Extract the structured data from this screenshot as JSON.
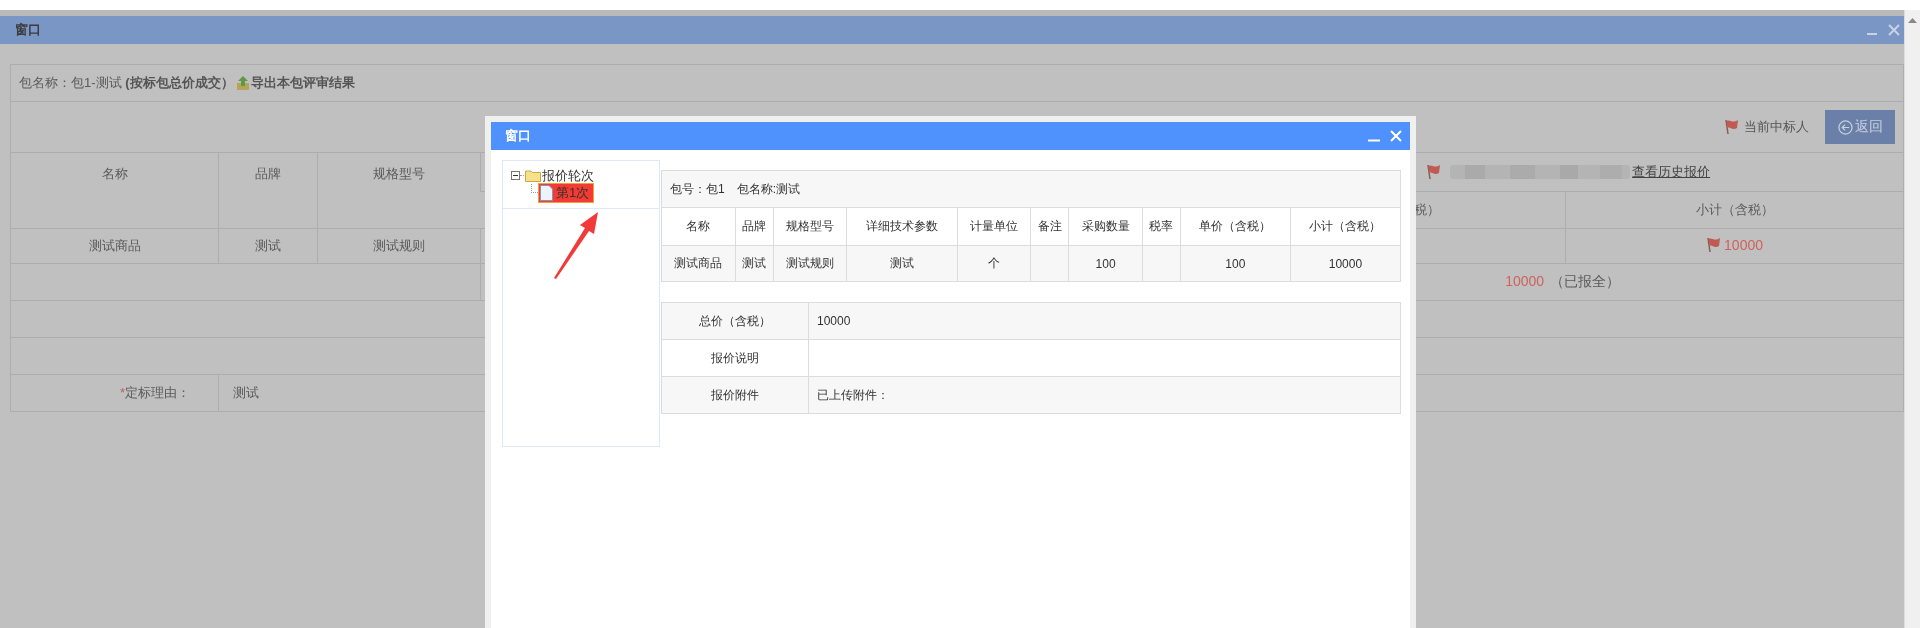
{
  "background_window": {
    "title": "窗口",
    "package_line": {
      "text": "包名称：包1-测试 **(按标包总价成交）**",
      "export_link": "导出本包评审结果"
    },
    "toolbar": {
      "winner_legend": "当前中标人",
      "back_button": "返回"
    },
    "table": {
      "columns": [
        "名称",
        "品牌",
        "规格型号"
      ],
      "supplier": {
        "history_link": "查看历史报价",
        "column_fragment": "税）",
        "subtotal_header": "小计（含税）"
      },
      "rows": [
        {
          "cells": [
            "测试商品",
            "测试",
            "测试规则"
          ],
          "subtotal": "10000",
          "winner": true
        }
      ],
      "total": {
        "amount": "10000",
        "status": "（已报全）"
      },
      "reason": {
        "required_mark": "*",
        "label": "定标理由：",
        "value": "测试"
      }
    }
  },
  "dialog": {
    "title": "窗口",
    "tree": [
      {
        "label": "报价轮次",
        "expanded": true,
        "children": [
          {
            "label": "第1次",
            "selected": true
          }
        ]
      }
    ],
    "package_info": "包号：包1　包名称:测试",
    "items_table": {
      "columns": [
        "名称",
        "品牌",
        "规格型号",
        "详细技术参数",
        "计量单位",
        "备注",
        "采购数量",
        "税率",
        "单价（含税）",
        "小计（含税）"
      ],
      "rows": [
        {
          "cells": [
            "测试商品",
            "测试",
            "测试规则",
            "测试",
            "个",
            null,
            "100",
            null,
            "100",
            "10000"
          ]
        }
      ]
    },
    "summary": [
      {
        "label": "总价（含税）",
        "value": "10000"
      },
      {
        "label": "报价说明"
      },
      {
        "label": "报价附件",
        "value": "已上传附件："
      }
    ]
  }
}
